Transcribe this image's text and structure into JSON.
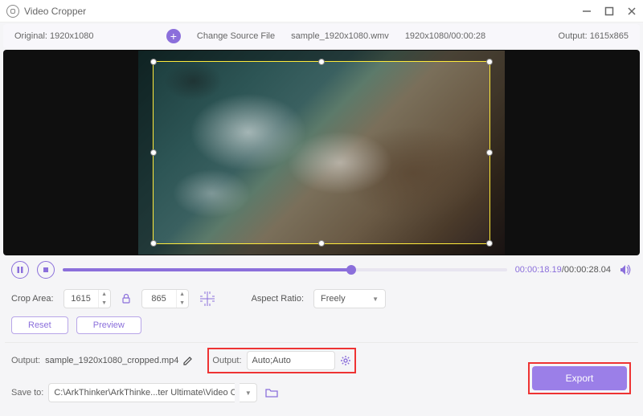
{
  "app": {
    "title": "Video Cropper"
  },
  "infobar": {
    "original_label": "Original:",
    "original_value": "1920x1080",
    "change_source": "Change Source File",
    "filename": "sample_1920x1080.wmv",
    "resolution_time": "1920x1080/00:00:28",
    "output_label": "Output:",
    "output_value": "1615x865"
  },
  "playback": {
    "current": "00:00:18.19",
    "total": "00:00:28.04",
    "progress_pct": 65
  },
  "crop": {
    "area_label": "Crop Area:",
    "width": "1615",
    "height": "865",
    "aspect_label": "Aspect Ratio:",
    "aspect_value": "Freely",
    "rect": {
      "left_pct": 4,
      "top_pct": 5,
      "width_pct": 92,
      "height_pct": 90
    }
  },
  "buttons": {
    "reset": "Reset",
    "preview": "Preview",
    "export": "Export"
  },
  "output": {
    "file_label": "Output:",
    "file_value": "sample_1920x1080_cropped.mp4",
    "settings_label": "Output:",
    "settings_value": "Auto;Auto"
  },
  "saveto": {
    "label": "Save to:",
    "path": "C:\\ArkThinker\\ArkThinke...ter Ultimate\\Video Crop"
  }
}
